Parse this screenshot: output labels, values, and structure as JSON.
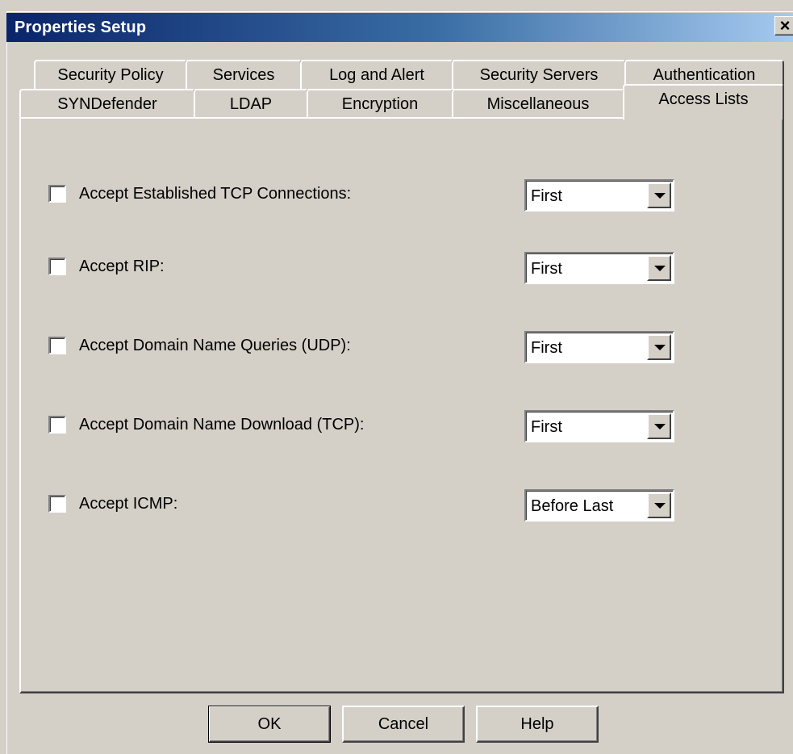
{
  "window": {
    "title": "Properties Setup",
    "close_label": "×"
  },
  "tabs": {
    "row_back": [
      "Security Policy",
      "Services",
      "Log and Alert",
      "Security Servers",
      "Authentication"
    ],
    "row_front": [
      "SYNDefender",
      "LDAP",
      "Encryption",
      "Miscellaneous",
      "Access Lists"
    ],
    "selected": "Access Lists"
  },
  "rows": [
    {
      "label": "Accept Established TCP Connections:",
      "checked": false,
      "position": "First"
    },
    {
      "label": "Accept RIP:",
      "checked": false,
      "position": "First"
    },
    {
      "label": "Accept Domain Name Queries (UDP):",
      "checked": false,
      "position": "First"
    },
    {
      "label": "Accept Domain Name Download (TCP):",
      "checked": false,
      "position": "First"
    },
    {
      "label": "Accept ICMP:",
      "checked": false,
      "position": "Before Last"
    }
  ],
  "buttons": {
    "ok": "OK",
    "cancel": "Cancel",
    "help": "Help"
  },
  "colors": {
    "face": "#d4d0c8",
    "title_start": "#0a246a",
    "title_end": "#a6caf0"
  }
}
